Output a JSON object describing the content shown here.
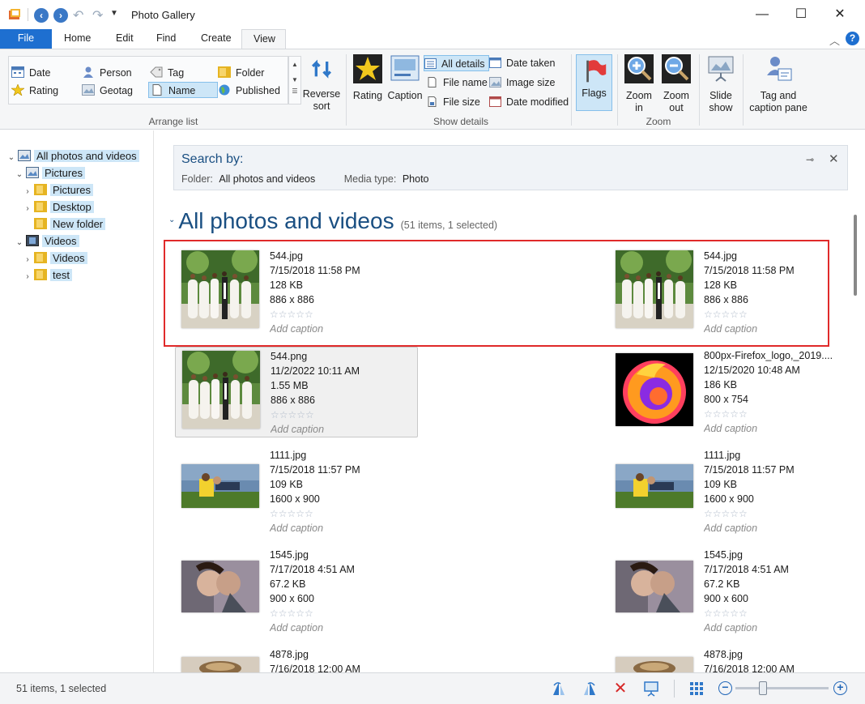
{
  "window": {
    "title": "Photo Gallery",
    "minimize": "—",
    "maximize": "☐",
    "close": "✕"
  },
  "menu": {
    "tabs": [
      "File",
      "Home",
      "Edit",
      "Find",
      "Create",
      "View"
    ],
    "active_tab": "View",
    "collapse_ribbon": "︿",
    "help": "?"
  },
  "ribbon": {
    "arrange_list": {
      "label": "Arrange list",
      "items": [
        "Date",
        "Person",
        "Tag",
        "Folder",
        "Rating",
        "Geotag",
        "Name",
        "Published"
      ],
      "selected": "Name"
    },
    "reverse_sort": "Reverse sort",
    "rating": "Rating",
    "caption": "Caption",
    "show_details": {
      "label": "Show details",
      "all_details": "All details",
      "file_name": "File name",
      "file_size": "File size",
      "date_taken": "Date taken",
      "image_size": "Image size",
      "date_modified": "Date modified"
    },
    "flags": "Flags",
    "zoom": {
      "label": "Zoom",
      "zoom_in": "Zoom in",
      "zoom_out": "Zoom out"
    },
    "slide_show": "Slide show",
    "tag_caption_pane": "Tag and caption pane"
  },
  "tree": {
    "root": "All photos and videos",
    "pictures": "Pictures",
    "pictures_children": [
      "Pictures",
      "Desktop",
      "New folder"
    ],
    "videos": "Videos",
    "videos_children": [
      "Videos",
      "test"
    ]
  },
  "search": {
    "title": "Search by:",
    "folder_label": "Folder:",
    "folder_value": "All photos and videos",
    "media_label": "Media type:",
    "media_value": "Photo"
  },
  "content": {
    "heading": "All photos and videos",
    "count": "(51 items, 1 selected)",
    "items": [
      {
        "name": "544.jpg",
        "date": "7/15/2018 11:58 PM",
        "size": "128 KB",
        "dims": "886 x 886",
        "caption": "Add caption",
        "thumb": "wedding"
      },
      {
        "name": "544.jpg",
        "date": "7/15/2018 11:58 PM",
        "size": "128 KB",
        "dims": "886 x 886",
        "caption": "Add caption",
        "thumb": "wedding"
      },
      {
        "name": "544.png",
        "date": "11/2/2022 10:11 AM",
        "size": "1.55 MB",
        "dims": "886 x 886",
        "caption": "Add caption",
        "thumb": "wedding"
      },
      {
        "name": "800px-Firefox_logo,_2019....",
        "date": "12/15/2020 10:48 AM",
        "size": "186 KB",
        "dims": "800 x 754",
        "caption": "Add caption",
        "thumb": "firefox"
      },
      {
        "name": "1111.jpg",
        "date": "7/15/2018 11:57 PM",
        "size": "109 KB",
        "dims": "1600 x 900",
        "caption": "Add caption",
        "thumb": "couple-field"
      },
      {
        "name": "1111.jpg",
        "date": "7/15/2018 11:57 PM",
        "size": "109 KB",
        "dims": "1600 x 900",
        "caption": "Add caption",
        "thumb": "couple-field"
      },
      {
        "name": "1545.jpg",
        "date": "7/17/2018 4:51 AM",
        "size": "67.2 KB",
        "dims": "900 x 600",
        "caption": "Add caption",
        "thumb": "couple-kiss"
      },
      {
        "name": "1545.jpg",
        "date": "7/17/2018 4:51 AM",
        "size": "67.2 KB",
        "dims": "900 x 600",
        "caption": "Add caption",
        "thumb": "couple-kiss"
      },
      {
        "name": "4878.jpg",
        "date": "7/16/2018 12:00 AM",
        "size": "",
        "dims": "",
        "caption": "",
        "thumb": "cup"
      },
      {
        "name": "4878.jpg",
        "date": "7/16/2018 12:00 AM",
        "size": "",
        "dims": "",
        "caption": "",
        "thumb": "cup"
      }
    ],
    "rating_stars": "☆☆☆☆☆"
  },
  "status": {
    "text": "51 items, 1 selected"
  }
}
